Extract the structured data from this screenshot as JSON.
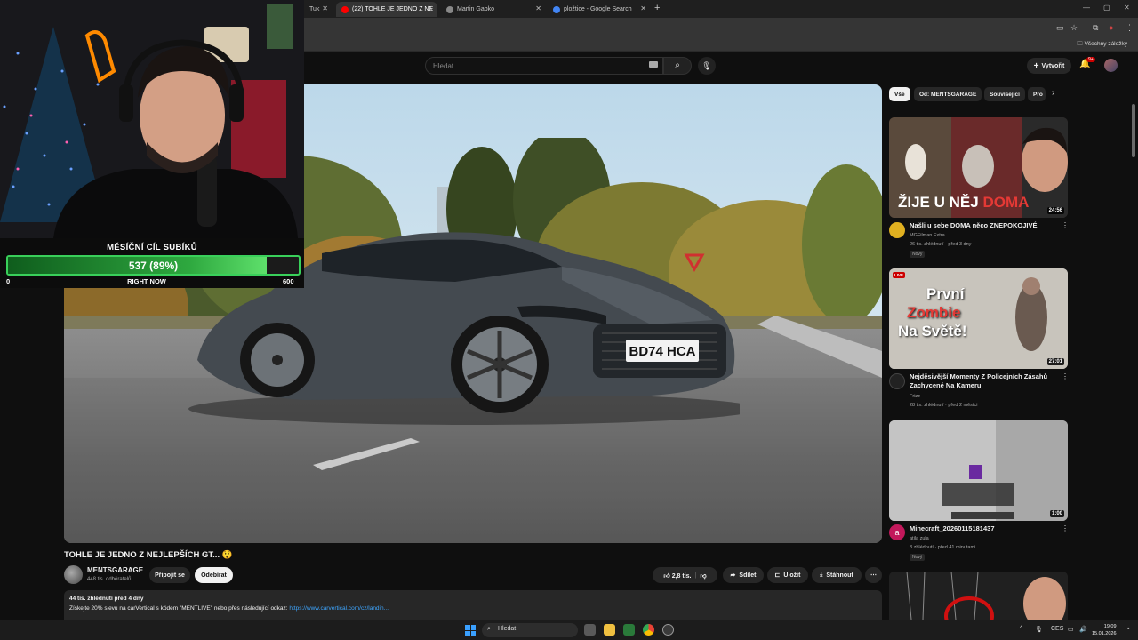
{
  "browser": {
    "tabs": [
      {
        "label": "Tuk",
        "active": false
      },
      {
        "label": "(22) TOHLE JE JEDNO Z NE",
        "active": true
      },
      {
        "label": "Martin Gabko",
        "active": false
      },
      {
        "label": "pložtice - Google Search",
        "active": false
      }
    ],
    "bookmarks_label": "Všechny záložky"
  },
  "header": {
    "search_placeholder": "Hledat",
    "create_label": "Vytvořit",
    "notifications_count": "9+"
  },
  "overlay": {
    "goal_title": "MĚSÍČNÍ CÍL SUBÍKŮ",
    "goal_value": "537 (89%)",
    "goal_progress": 0.89,
    "goal_min": "0",
    "goal_label": "RIGHT NOW",
    "goal_max": "600"
  },
  "player": {
    "plate": "BD74 HCA"
  },
  "video": {
    "title": "TOHLE JE JEDNO Z NEJLEPŠÍCH GT... 😲",
    "channel": "MENTSGARAGE",
    "subscribers": "448 tis. odběratelů",
    "join_label": "Připojit se",
    "subscribe_label": "Odebírat",
    "likes": "2,8 tis.",
    "share_label": "Sdílet",
    "save_label": "Uložit",
    "download_label": "Stáhnout",
    "description_meta": "44 tis. zhlédnutí  před 4 dny",
    "description_text": "Získejte 20% slevu na carVertical s kódem \"MENTLIVE\" nebo přes následující odkaz: ",
    "description_link": "https://www.carvertical.com/cz/landin..."
  },
  "chips": [
    "Vše",
    "Od: MENTSGARAGE",
    "Související",
    "Pro"
  ],
  "recommendations": [
    {
      "thumb_text": "ŽIJE U NĚJ",
      "thumb_text_red": "DOMA",
      "duration": "24:56",
      "title": "Našli u sebe DOMA něco ZNEPOKOJIVÉ",
      "channel": "MGFilman Extra",
      "meta": "26 tis. zhlédnutí · před 3 dny",
      "badge": "Nový",
      "avatar_color": "#e0b020"
    },
    {
      "thumb_line1": "První",
      "thumb_line2": "Zombie",
      "thumb_line3": "Na Světě!",
      "live_label": "LIVE",
      "duration": "27:01",
      "title": "Nejděsivější Momenty Z Policejních Zásahů Zachycené Na Kameru",
      "channel": "Frizz",
      "meta": "28 tis. zhlédnutí · před 2 měsíci",
      "avatar_color": "#333333"
    },
    {
      "duration": "1:00",
      "title": "Minecraft_20260115181437",
      "channel": "atila zula",
      "meta": "3 zhlédnutí · před 41 minutami",
      "badge": "Nový",
      "avatar_letter": "a",
      "avatar_color": "#c2185b"
    }
  ],
  "taskbar": {
    "search_label": "Hledat",
    "lang": "CES",
    "time": "19:09",
    "date": "15.01.2026"
  }
}
